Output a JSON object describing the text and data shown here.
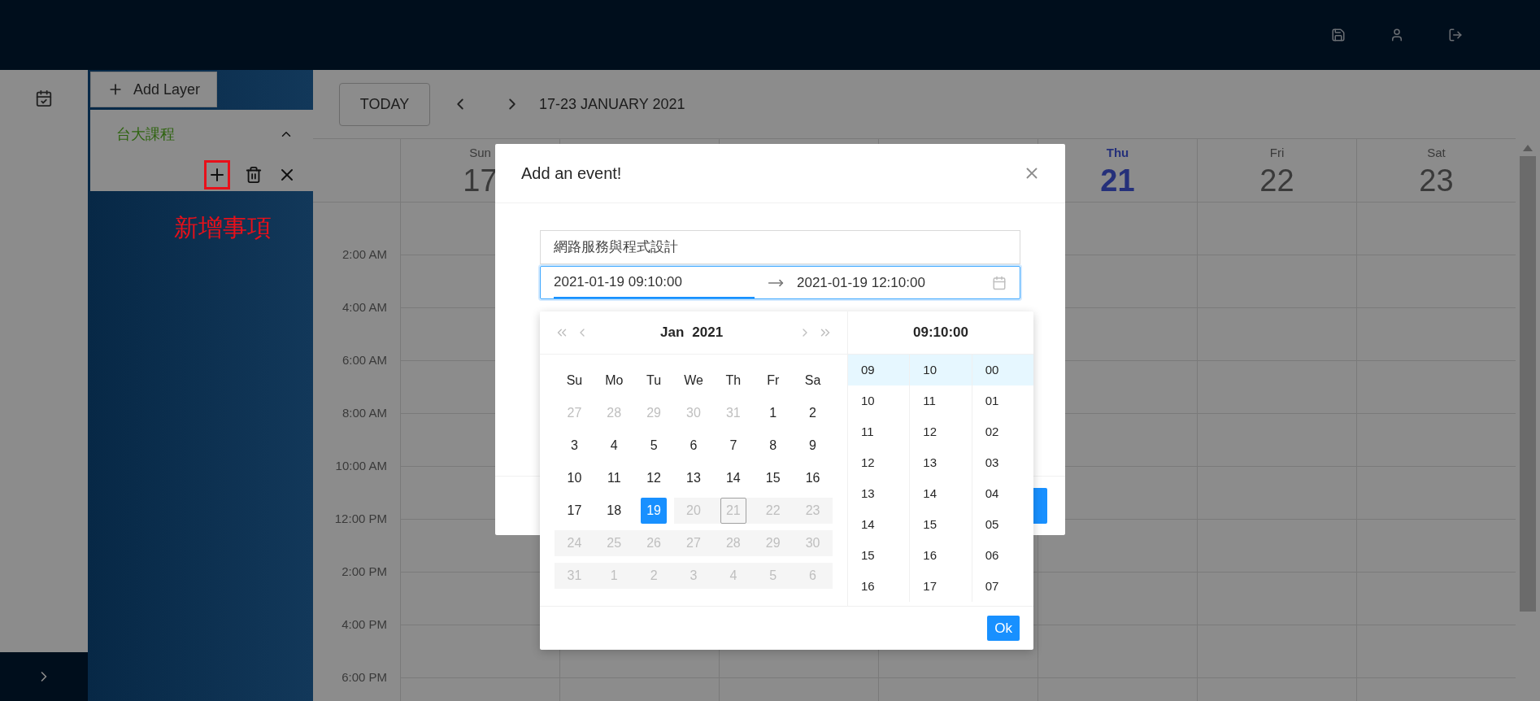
{
  "layers": {
    "add_button": "Add Layer",
    "items": [
      {
        "name": "台大課程",
        "expanded": true
      }
    ]
  },
  "annotation": {
    "text": "新增事項"
  },
  "calendar": {
    "today_button": "TODAY",
    "range": "17-23 JANUARY 2021",
    "days": [
      {
        "weekday": "Sun",
        "date": "17",
        "today": false
      },
      {
        "weekday": "Thu",
        "date": "21",
        "today": true
      },
      {
        "weekday": "Fri",
        "date": "22",
        "today": false
      },
      {
        "weekday": "Sat",
        "date": "23",
        "today": false
      }
    ],
    "time_labels": [
      "2:00 AM",
      "4:00 AM",
      "6:00 AM",
      "8:00 AM",
      "10:00 AM",
      "12:00 PM",
      "2:00 PM",
      "4:00 PM",
      "6:00 PM"
    ]
  },
  "modal": {
    "title": "Add an event!",
    "name_value": "網路服務與程式設計",
    "start": "2021-01-19 09:10:00",
    "end": "2021-01-19 12:10:00",
    "picker": {
      "month": "Jan",
      "year": "2021",
      "weekdays": [
        "Su",
        "Mo",
        "Tu",
        "We",
        "Th",
        "Fr",
        "Sa"
      ],
      "weeks": [
        [
          {
            "label": "27",
            "muted": true,
            "in_range": false,
            "selected": false,
            "today": false
          },
          {
            "label": "28",
            "muted": true,
            "in_range": false,
            "selected": false,
            "today": false
          },
          {
            "label": "29",
            "muted": true,
            "in_range": false,
            "selected": false,
            "today": false
          },
          {
            "label": "30",
            "muted": true,
            "in_range": false,
            "selected": false,
            "today": false
          },
          {
            "label": "31",
            "muted": true,
            "in_range": false,
            "selected": false,
            "today": false
          },
          {
            "label": "1",
            "muted": false,
            "in_range": false,
            "selected": false,
            "today": false
          },
          {
            "label": "2",
            "muted": false,
            "in_range": false,
            "selected": false,
            "today": false
          }
        ],
        [
          {
            "label": "3",
            "muted": false,
            "in_range": false,
            "selected": false,
            "today": false
          },
          {
            "label": "4",
            "muted": false,
            "in_range": false,
            "selected": false,
            "today": false
          },
          {
            "label": "5",
            "muted": false,
            "in_range": false,
            "selected": false,
            "today": false
          },
          {
            "label": "6",
            "muted": false,
            "in_range": false,
            "selected": false,
            "today": false
          },
          {
            "label": "7",
            "muted": false,
            "in_range": false,
            "selected": false,
            "today": false
          },
          {
            "label": "8",
            "muted": false,
            "in_range": false,
            "selected": false,
            "today": false
          },
          {
            "label": "9",
            "muted": false,
            "in_range": false,
            "selected": false,
            "today": false
          }
        ],
        [
          {
            "label": "10",
            "muted": false,
            "in_range": false,
            "selected": false,
            "today": false
          },
          {
            "label": "11",
            "muted": false,
            "in_range": false,
            "selected": false,
            "today": false
          },
          {
            "label": "12",
            "muted": false,
            "in_range": false,
            "selected": false,
            "today": false
          },
          {
            "label": "13",
            "muted": false,
            "in_range": false,
            "selected": false,
            "today": false
          },
          {
            "label": "14",
            "muted": false,
            "in_range": false,
            "selected": false,
            "today": false
          },
          {
            "label": "15",
            "muted": false,
            "in_range": false,
            "selected": false,
            "today": false
          },
          {
            "label": "16",
            "muted": false,
            "in_range": false,
            "selected": false,
            "today": false
          }
        ],
        [
          {
            "label": "17",
            "muted": false,
            "in_range": false,
            "selected": false,
            "today": false
          },
          {
            "label": "18",
            "muted": false,
            "in_range": false,
            "selected": false,
            "today": false
          },
          {
            "label": "19",
            "muted": false,
            "in_range": false,
            "selected": true,
            "today": false
          },
          {
            "label": "20",
            "muted": true,
            "in_range": true,
            "selected": false,
            "today": false
          },
          {
            "label": "21",
            "muted": true,
            "in_range": true,
            "selected": false,
            "today": true
          },
          {
            "label": "22",
            "muted": true,
            "in_range": true,
            "selected": false,
            "today": false
          },
          {
            "label": "23",
            "muted": true,
            "in_range": true,
            "selected": false,
            "today": false
          }
        ],
        [
          {
            "label": "24",
            "muted": true,
            "in_range": true,
            "selected": false,
            "today": false
          },
          {
            "label": "25",
            "muted": true,
            "in_range": true,
            "selected": false,
            "today": false
          },
          {
            "label": "26",
            "muted": true,
            "in_range": true,
            "selected": false,
            "today": false
          },
          {
            "label": "27",
            "muted": true,
            "in_range": true,
            "selected": false,
            "today": false
          },
          {
            "label": "28",
            "muted": true,
            "in_range": true,
            "selected": false,
            "today": false
          },
          {
            "label": "29",
            "muted": true,
            "in_range": true,
            "selected": false,
            "today": false
          },
          {
            "label": "30",
            "muted": true,
            "in_range": true,
            "selected": false,
            "today": false
          }
        ],
        [
          {
            "label": "31",
            "muted": true,
            "in_range": true,
            "selected": false,
            "today": false
          },
          {
            "label": "1",
            "muted": true,
            "in_range": true,
            "selected": false,
            "today": false
          },
          {
            "label": "2",
            "muted": true,
            "in_range": true,
            "selected": false,
            "today": false
          },
          {
            "label": "3",
            "muted": true,
            "in_range": true,
            "selected": false,
            "today": false
          },
          {
            "label": "4",
            "muted": true,
            "in_range": true,
            "selected": false,
            "today": false
          },
          {
            "label": "5",
            "muted": true,
            "in_range": true,
            "selected": false,
            "today": false
          },
          {
            "label": "6",
            "muted": true,
            "in_range": true,
            "selected": false,
            "today": false
          }
        ]
      ],
      "time": "09:10:00",
      "hours": [
        {
          "label": "09",
          "selected": true
        },
        {
          "label": "10",
          "selected": false
        },
        {
          "label": "11",
          "selected": false
        },
        {
          "label": "12",
          "selected": false
        },
        {
          "label": "13",
          "selected": false
        },
        {
          "label": "14",
          "selected": false
        },
        {
          "label": "15",
          "selected": false
        },
        {
          "label": "16",
          "selected": false
        }
      ],
      "minutes": [
        {
          "label": "10",
          "selected": true
        },
        {
          "label": "11",
          "selected": false
        },
        {
          "label": "12",
          "selected": false
        },
        {
          "label": "13",
          "selected": false
        },
        {
          "label": "14",
          "selected": false
        },
        {
          "label": "15",
          "selected": false
        },
        {
          "label": "16",
          "selected": false
        },
        {
          "label": "17",
          "selected": false
        }
      ],
      "seconds": [
        {
          "label": "00",
          "selected": true
        },
        {
          "label": "01",
          "selected": false
        },
        {
          "label": "02",
          "selected": false
        },
        {
          "label": "03",
          "selected": false
        },
        {
          "label": "04",
          "selected": false
        },
        {
          "label": "05",
          "selected": false
        },
        {
          "label": "06",
          "selected": false
        },
        {
          "label": "07",
          "selected": false
        }
      ],
      "ok": "Ok"
    }
  }
}
